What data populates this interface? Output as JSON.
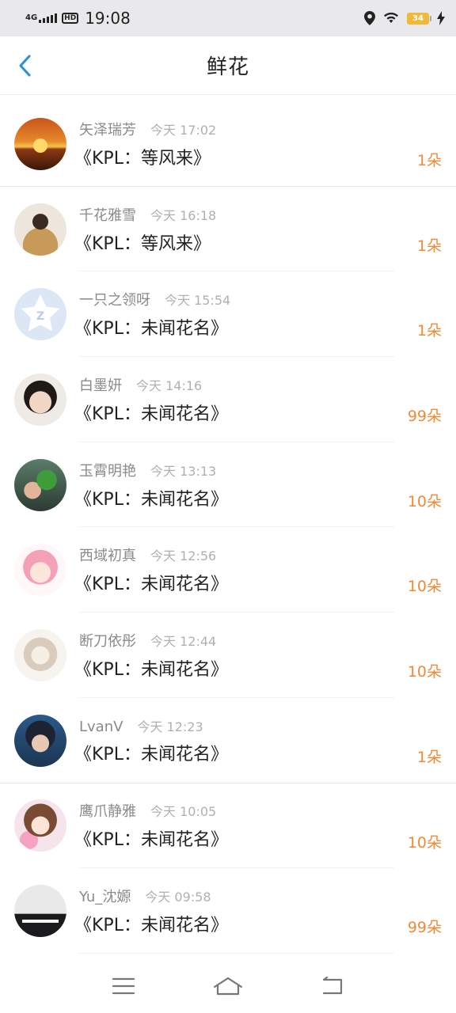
{
  "status_bar": {
    "network": "4G",
    "hd": "HD",
    "time": "19:08",
    "battery": "34",
    "icons": [
      "signal-icon",
      "location-icon",
      "wifi-icon",
      "battery-icon",
      "charging-icon"
    ]
  },
  "header": {
    "title": "鲜花",
    "back_icon": "chevron-left-icon"
  },
  "colors": {
    "accent": "#2a8fd8",
    "count": "#ee8a37"
  },
  "records": [
    {
      "name": "矢泽瑞芳",
      "time": "今天 17:02",
      "gift": "《KPL：等风来》",
      "count": "1朵"
    },
    {
      "name": "千花雅雪",
      "time": "今天 16:18",
      "gift": "《KPL：等风来》",
      "count": "1朵"
    },
    {
      "name": "一只之领呀",
      "time": "今天 15:54",
      "gift": "《KPL：未闻花名》",
      "count": "1朵"
    },
    {
      "name": "白墨妍",
      "time": "今天 14:16",
      "gift": "《KPL：未闻花名》",
      "count": "99朵"
    },
    {
      "name": "玉霄明艳",
      "time": "今天 13:13",
      "gift": "《KPL：未闻花名》",
      "count": "10朵"
    },
    {
      "name": "西域初真",
      "time": "今天 12:56",
      "gift": "《KPL：未闻花名》",
      "count": "10朵"
    },
    {
      "name": "断刀依彤",
      "time": "今天 12:44",
      "gift": "《KPL：未闻花名》",
      "count": "10朵"
    },
    {
      "name": "LvanV",
      "time": "今天 12:23",
      "gift": "《KPL：未闻花名》",
      "count": "1朵"
    },
    {
      "name": "鹰爪静雅",
      "time": "今天 10:05",
      "gift": "《KPL：未闻花名》",
      "count": "10朵"
    },
    {
      "name": "Yu_沈嫄",
      "time": "今天 09:58",
      "gift": "《KPL：未闻花名》",
      "count": "99朵"
    }
  ],
  "nav": {
    "icons": [
      "menu-icon",
      "home-icon",
      "back-icon"
    ]
  }
}
